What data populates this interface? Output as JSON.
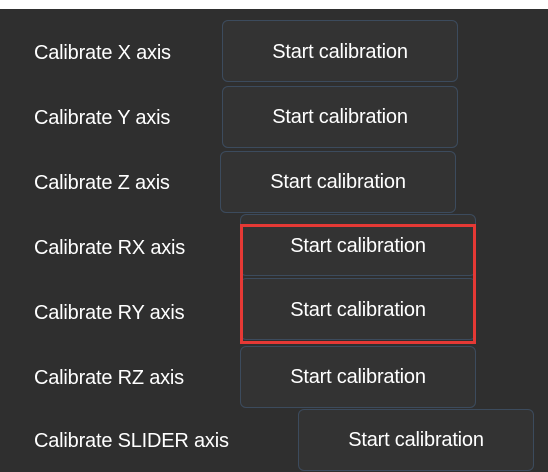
{
  "rows": [
    {
      "label": "Calibrate X axis",
      "button_label": "Start calibration"
    },
    {
      "label": "Calibrate Y axis",
      "button_label": "Start calibration"
    },
    {
      "label": "Calibrate Z axis",
      "button_label": "Start calibration"
    },
    {
      "label": "Calibrate RX axis",
      "button_label": "Start calibration"
    },
    {
      "label": "Calibrate RY axis",
      "button_label": "Start calibration"
    },
    {
      "label": "Calibrate RZ axis",
      "button_label": "Start calibration"
    },
    {
      "label": "Calibrate SLIDER axis",
      "button_label": "Start calibration"
    }
  ],
  "colors": {
    "panel_background": "#2f2f2f",
    "button_background": "#333333",
    "button_border": "#3c4b5d",
    "text": "#ffffff",
    "highlight": "#e53935"
  }
}
